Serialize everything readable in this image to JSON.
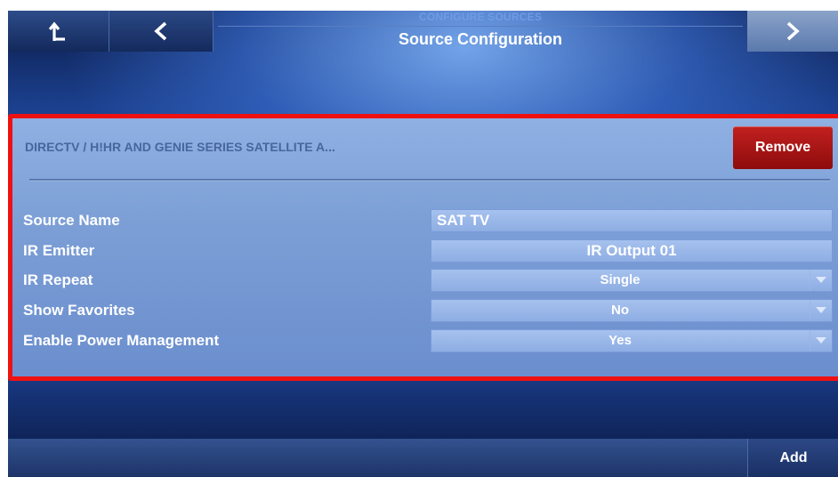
{
  "header": {
    "subtitle": "CONFIGURE SOURCES",
    "title": "Source Configuration",
    "home_icon": "return-up-icon",
    "back_icon": "chevron-left-icon",
    "next_icon": "chevron-right-icon"
  },
  "panel": {
    "device_name": "DIRECTV / H!HR AND GENIE SERIES SATELLITE A...",
    "remove_label": "Remove",
    "rows": [
      {
        "label": "Source Name",
        "value": "SAT TV"
      },
      {
        "label": "IR Emitter",
        "value": "IR Output 01"
      },
      {
        "label": "IR Repeat",
        "value": "Single"
      },
      {
        "label": "Show Favorites",
        "value": "No"
      },
      {
        "label": "Enable Power Management",
        "value": "Yes"
      }
    ],
    "highlight_color": "#ee1111"
  },
  "footer": {
    "add_label": "Add"
  }
}
